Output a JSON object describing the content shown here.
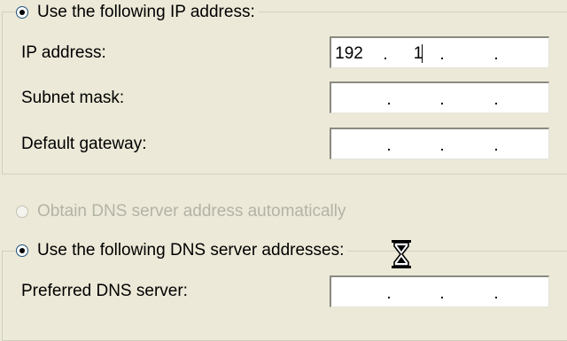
{
  "ip_section": {
    "radio_label": "Use the following IP address:",
    "fields": [
      {
        "label": "IP address:",
        "octets": [
          "192",
          "1",
          "",
          ""
        ]
      },
      {
        "label": "Subnet mask:",
        "octets": [
          "",
          "",
          "",
          ""
        ]
      },
      {
        "label": "Default gateway:",
        "octets": [
          "",
          "",
          "",
          ""
        ]
      }
    ]
  },
  "dns_section": {
    "auto_radio_label": "Obtain DNS server address automatically",
    "manual_radio_label": "Use the following DNS server addresses:",
    "fields": [
      {
        "label": "Preferred DNS server:",
        "octets": [
          "",
          "",
          "",
          ""
        ]
      }
    ]
  },
  "dot_separator": ".",
  "cursor_icon": "hourglass-icon"
}
